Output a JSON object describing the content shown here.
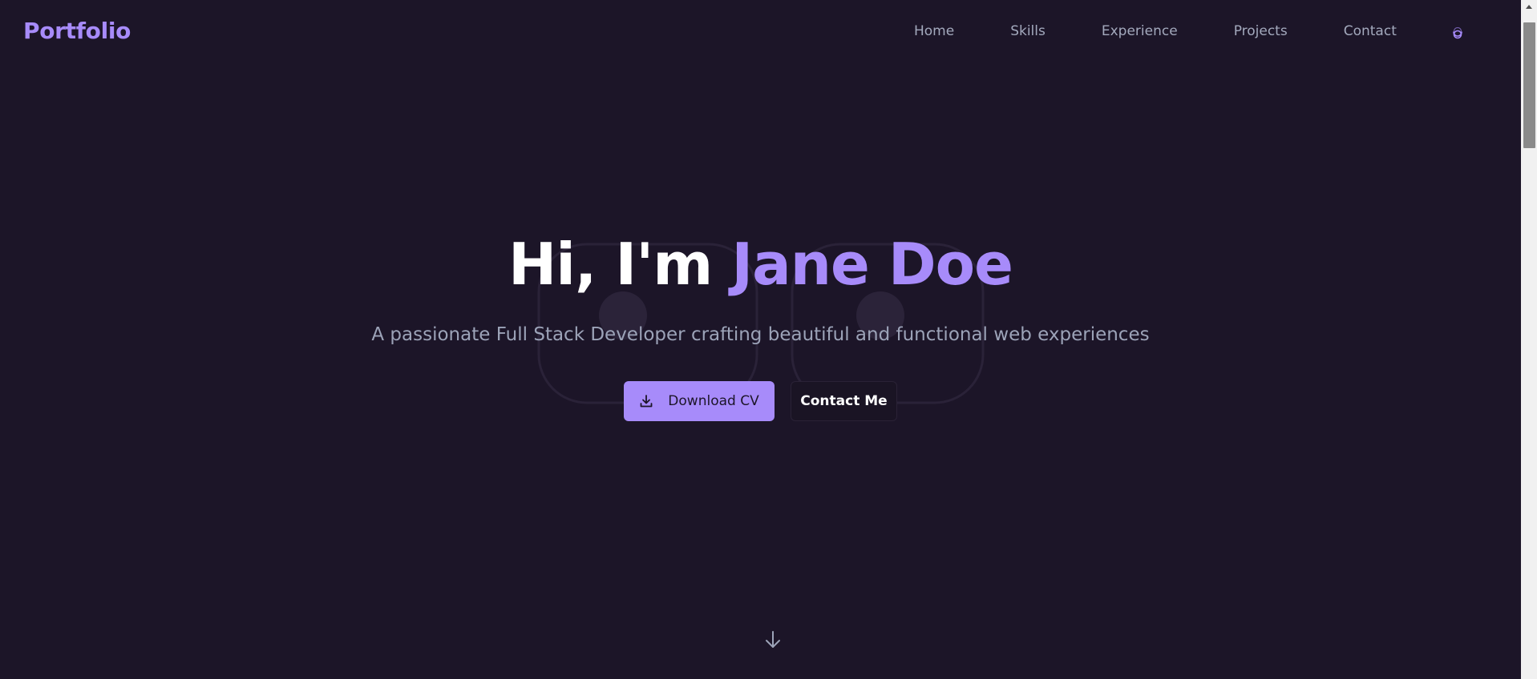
{
  "header": {
    "brand": "Portfolio",
    "nav": [
      "Home",
      "Skills",
      "Experience",
      "Projects",
      "Contact"
    ],
    "theme_icon": "moon-icon"
  },
  "hero": {
    "greeting": "Hi, I'm",
    "name": "Jane Doe",
    "subtitle": "A passionate Full Stack Developer crafting beautiful and functional web experiences",
    "primary_button": "Download CV",
    "primary_icon": "download-icon",
    "secondary_button": "Contact Me",
    "scroll_icon": "arrow-down-icon"
  },
  "colors": {
    "background": "#1c1528",
    "accent": "#a78bfa",
    "nav_text": "#a3a9bd",
    "subtitle_text": "#9ca3b8",
    "heading_text": "#ffffff"
  }
}
